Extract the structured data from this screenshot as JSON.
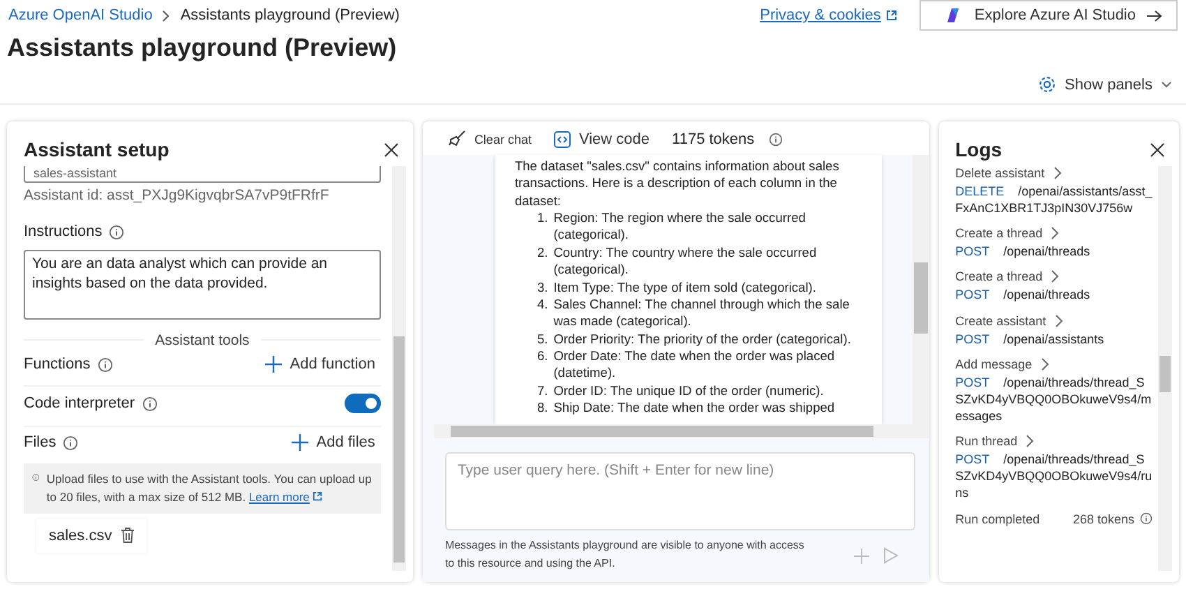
{
  "breadcrumb": {
    "root": "Azure OpenAI Studio",
    "current": "Assistants playground (Preview)"
  },
  "privacy_link": "Privacy & cookies",
  "explore_button": "Explore Azure AI Studio",
  "page_title": "Assistants playground (Preview)",
  "show_panels": "Show panels",
  "setup": {
    "title": "Assistant setup",
    "name_value": "sales-assistant",
    "assistant_id": "Assistant id: asst_PXJg9KigvqbrSA7vP9tFRfrF",
    "instructions_label": "Instructions",
    "instructions_value": "You are an data analyst which can provide an insights based on the data provided.",
    "tools_heading": "Assistant tools",
    "functions_label": "Functions",
    "add_function": "Add function",
    "code_interpreter": {
      "label": "Code interpreter",
      "on": true
    },
    "files_label": "Files",
    "add_files": "Add files",
    "upload_note": "Upload files to use with the Assistant tools. You can upload up to 20 files, with a max size of 512 MB.",
    "learn_more": "Learn more",
    "files": [
      "sales.csv"
    ]
  },
  "chat": {
    "clear_chat": "Clear chat",
    "view_code": "View code",
    "tokens": "1175 tokens",
    "message_intro": "The dataset \"sales.csv\" contains information about sales transactions. Here is a description of each column in the dataset:",
    "items": [
      {
        "number": "1.",
        "text": "Region: The region where the sale occurred (categorical)."
      },
      {
        "number": "2.",
        "text": "Country: The country where the sale occurred (categorical)."
      },
      {
        "number": "3.",
        "text": "Item Type: The type of item sold (categorical)."
      },
      {
        "number": "4.",
        "text": "Sales Channel: The channel through which the sale was made (categorical)."
      },
      {
        "number": "5.",
        "text": "Order Priority: The priority of the order (categorical)."
      },
      {
        "number": "6.",
        "text": "Order Date: The date when the order was placed (datetime)."
      },
      {
        "number": "7.",
        "text": "Order ID: The unique ID of the order (numeric)."
      },
      {
        "number": "8.",
        "text": "Ship Date: The date when the order was shipped"
      }
    ],
    "input_placeholder": "Type user query here. (Shift + Enter for new line)",
    "notice": "Messages in the Assistants playground are visible to anyone with access to this resource and using the API."
  },
  "logs": {
    "title": "Logs",
    "entries": [
      {
        "title": "Delete assistant",
        "method": "DELETE",
        "path": "/openai/assistants/asst_FxAnC1XBR1TJ3pIN30VJ756w"
      },
      {
        "title": "Create a thread",
        "method": "POST",
        "path": "/openai/threads"
      },
      {
        "title": "Create a thread",
        "method": "POST",
        "path": "/openai/threads"
      },
      {
        "title": "Create assistant",
        "method": "POST",
        "path": "/openai/assistants"
      },
      {
        "title": "Add message",
        "method": "POST",
        "path": "/openai/threads/thread_SSZvKD4yVBQQ0OBOkuweV9s4/messages"
      },
      {
        "title": "Run thread",
        "method": "POST",
        "path": "/openai/threads/thread_SSZvKD4yVBQQ0OBOkuweV9s4/runs"
      }
    ],
    "status": "Run completed",
    "status_tokens": "268 tokens"
  }
}
